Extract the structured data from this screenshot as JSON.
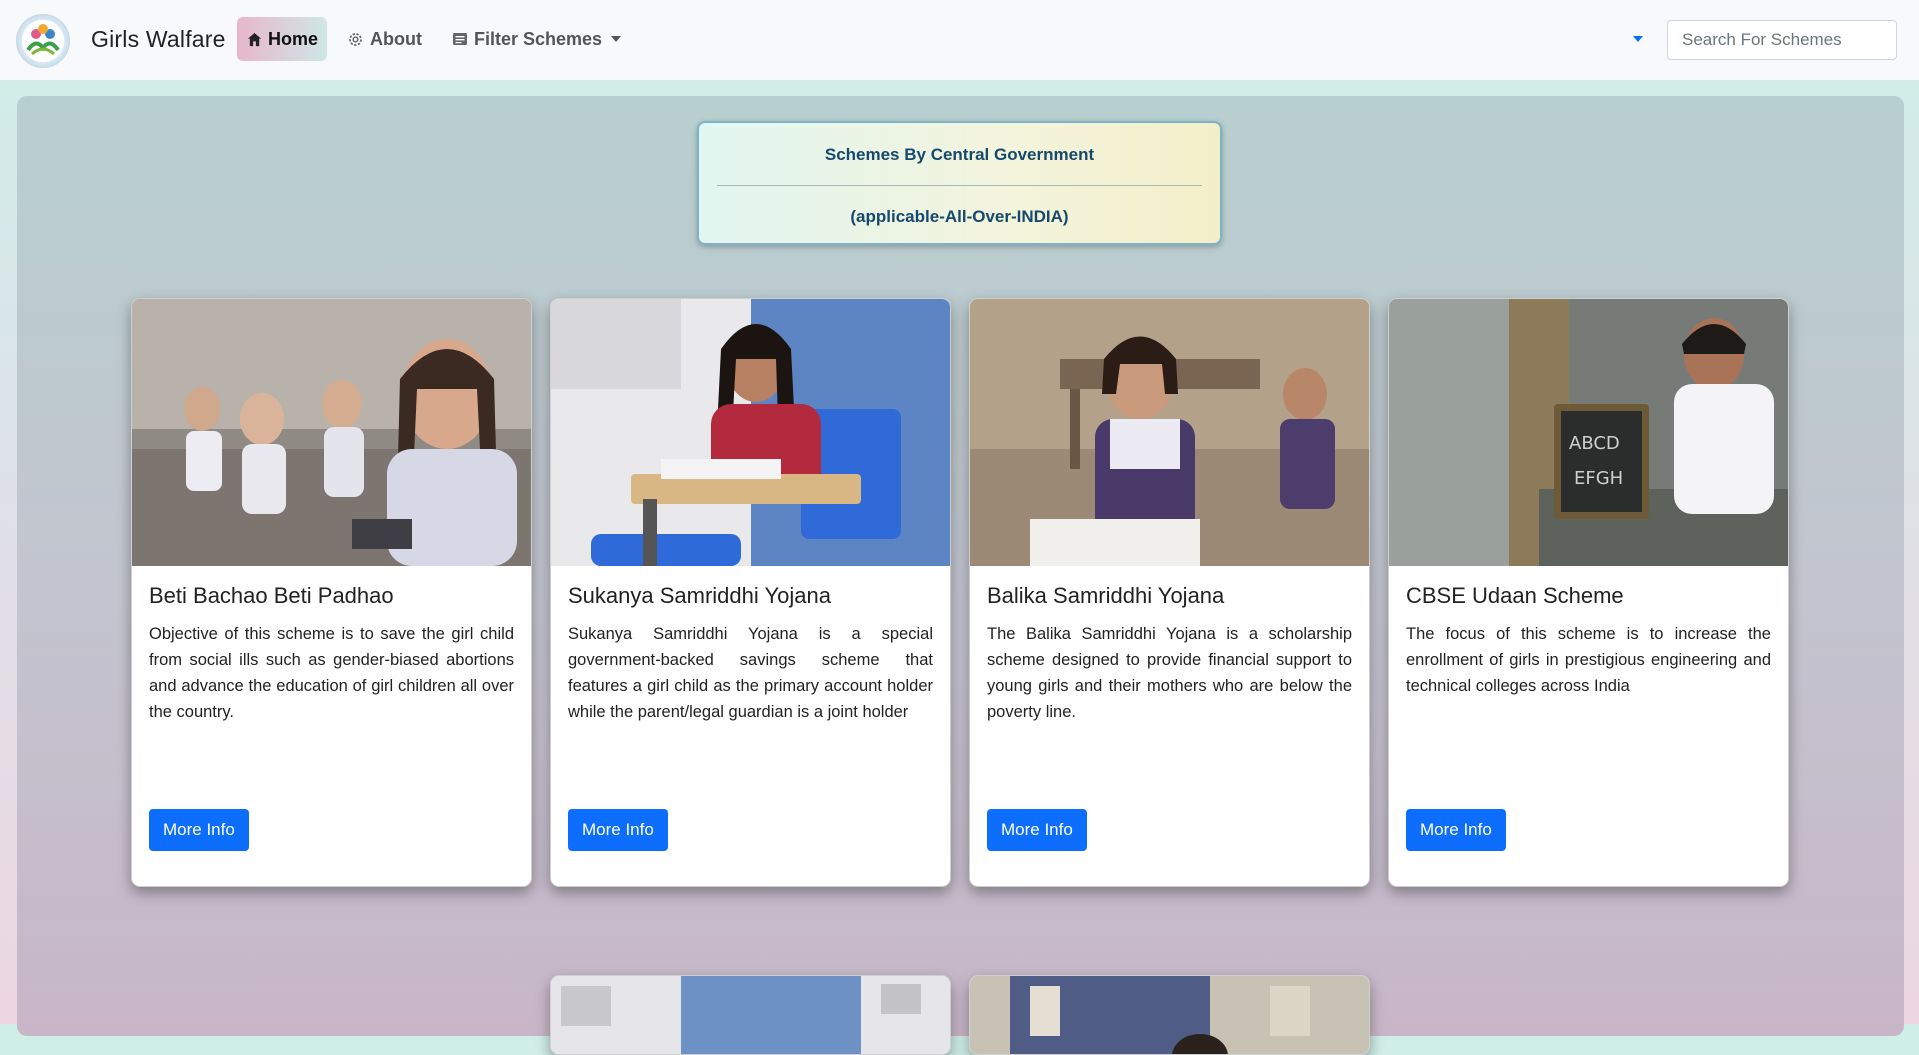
{
  "navbar": {
    "brand": "Girls Walfare",
    "logo_icon": "logo-icon",
    "items": [
      {
        "label": "Home",
        "icon": "home-icon",
        "active": true
      },
      {
        "label": "About",
        "icon": "gear-icon",
        "active": false
      },
      {
        "label": "Filter Schemes",
        "icon": "filter-icon",
        "active": false
      }
    ],
    "search_placeholder": "Search For Schemes",
    "search_value": ""
  },
  "heading": {
    "title": "Schemes By Central Government",
    "subtitle": "(applicable-All-Over-INDIA)"
  },
  "cards": [
    {
      "title": "Beti Bachao Beti Padhao",
      "description": "Objective of this scheme is to save the girl child from social ills such as gender-biased abortions and advance the education of girl children all over the country.",
      "button": "More Info"
    },
    {
      "title": "Sukanya Samriddhi Yojana",
      "description": "Sukanya Samriddhi Yojana is a special government-backed savings scheme that features a girl child as the primary account holder while the parent/legal guardian is a joint holder",
      "button": "More Info"
    },
    {
      "title": "Balika Samriddhi Yojana",
      "description": "The Balika Samriddhi Yojana is a scholarship scheme designed to provide financial support to young girls and their mothers who are below the poverty line.",
      "button": "More Info"
    },
    {
      "title": "CBSE Udaan Scheme",
      "description": "The focus of this scheme is to increase the enrollment of girls in prestigious engineering and technical colleges across India",
      "button": "More Info"
    }
  ],
  "colors": {
    "primary_button": "#0d6efd",
    "heading_text": "#17496c"
  }
}
